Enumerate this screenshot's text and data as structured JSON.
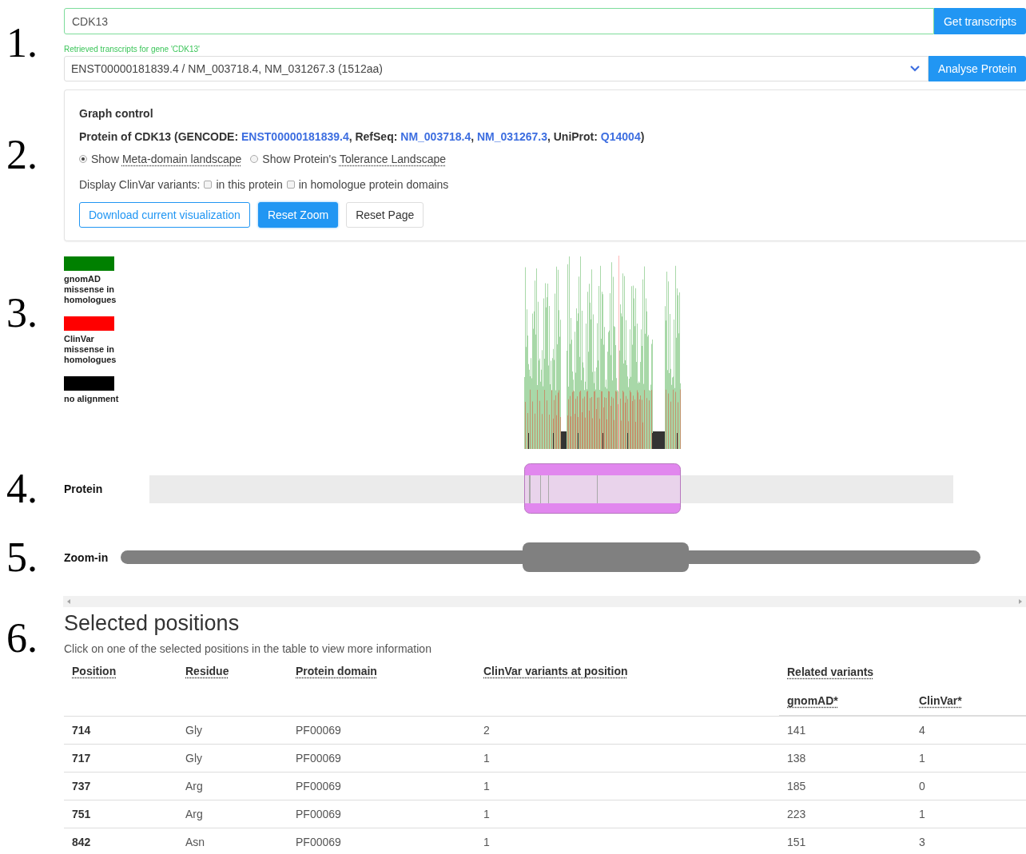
{
  "gene_search": {
    "step": "1.",
    "value": "CDK13",
    "button": "Get transcripts",
    "status": "Retrieved transcripts for gene 'CDK13'",
    "transcript": "ENST00000181839.4 / NM_003718.4, NM_031267.3 (1512aa)",
    "analyse_button": "Analyse Protein"
  },
  "graph_control": {
    "step": "2.",
    "title": "Graph control",
    "protein_info": [
      {
        "kind": "text",
        "text": "Protein of CDK13 (GENCODE: "
      },
      {
        "kind": "link",
        "text": "ENST00000181839.4"
      },
      {
        "kind": "text",
        "text": ", RefSeq: "
      },
      {
        "kind": "link",
        "text": "NM_003718.4"
      },
      {
        "kind": "text",
        "text": ", "
      },
      {
        "kind": "link",
        "text": "NM_031267.3"
      },
      {
        "kind": "text",
        "text": ", UniProt: "
      },
      {
        "kind": "link",
        "text": "Q14004"
      },
      {
        "kind": "text",
        "text": ")"
      }
    ],
    "views": [
      {
        "prefix": "Show",
        "term": "Meta-domain landscape",
        "selected": true
      },
      {
        "prefix": "Show Protein's",
        "term": "Tolerance Landscape",
        "selected": false
      }
    ],
    "clinvar": {
      "label": "Display ClinVar variants:",
      "options": [
        {
          "label": "in this protein",
          "checked": false
        },
        {
          "label": "in homologue protein domains",
          "checked": false
        }
      ]
    },
    "buttons": [
      {
        "label": "Download current visualization",
        "kind": "outline"
      },
      {
        "label": "Reset Zoom",
        "kind": "primary"
      },
      {
        "label": "Reset Page",
        "kind": "default"
      }
    ]
  },
  "landscape": {
    "step": "3.",
    "legend": [
      {
        "label": "gnomAD missense in homologues",
        "color": "#008000"
      },
      {
        "label": "ClinVar missense in homologues",
        "color": "#ff0000"
      },
      {
        "label": "no alignment",
        "color": "#000000"
      }
    ]
  },
  "protein_track": {
    "step": "4.",
    "label": "Protein"
  },
  "zoom": {
    "step": "5.",
    "label": "Zoom-in"
  },
  "selected_positions": {
    "step": "6.",
    "title": "Selected positions",
    "hint": "Click on one of the selected positions in the table to view more information",
    "columns": [
      "Position",
      "Residue",
      "Protein domain",
      "ClinVar variants at position"
    ],
    "group": {
      "label": "Related variants",
      "columns": [
        "gnomAD*",
        "ClinVar*"
      ]
    },
    "rows": [
      [
        "714",
        "Gly",
        "PF00069",
        "2",
        "141",
        "4"
      ],
      [
        "717",
        "Gly",
        "PF00069",
        "1",
        "138",
        "1"
      ],
      [
        "737",
        "Arg",
        "PF00069",
        "1",
        "185",
        "0"
      ],
      [
        "751",
        "Arg",
        "PF00069",
        "1",
        "223",
        "1"
      ],
      [
        "842",
        "Asn",
        "PF00069",
        "1",
        "151",
        "3"
      ]
    ]
  }
}
